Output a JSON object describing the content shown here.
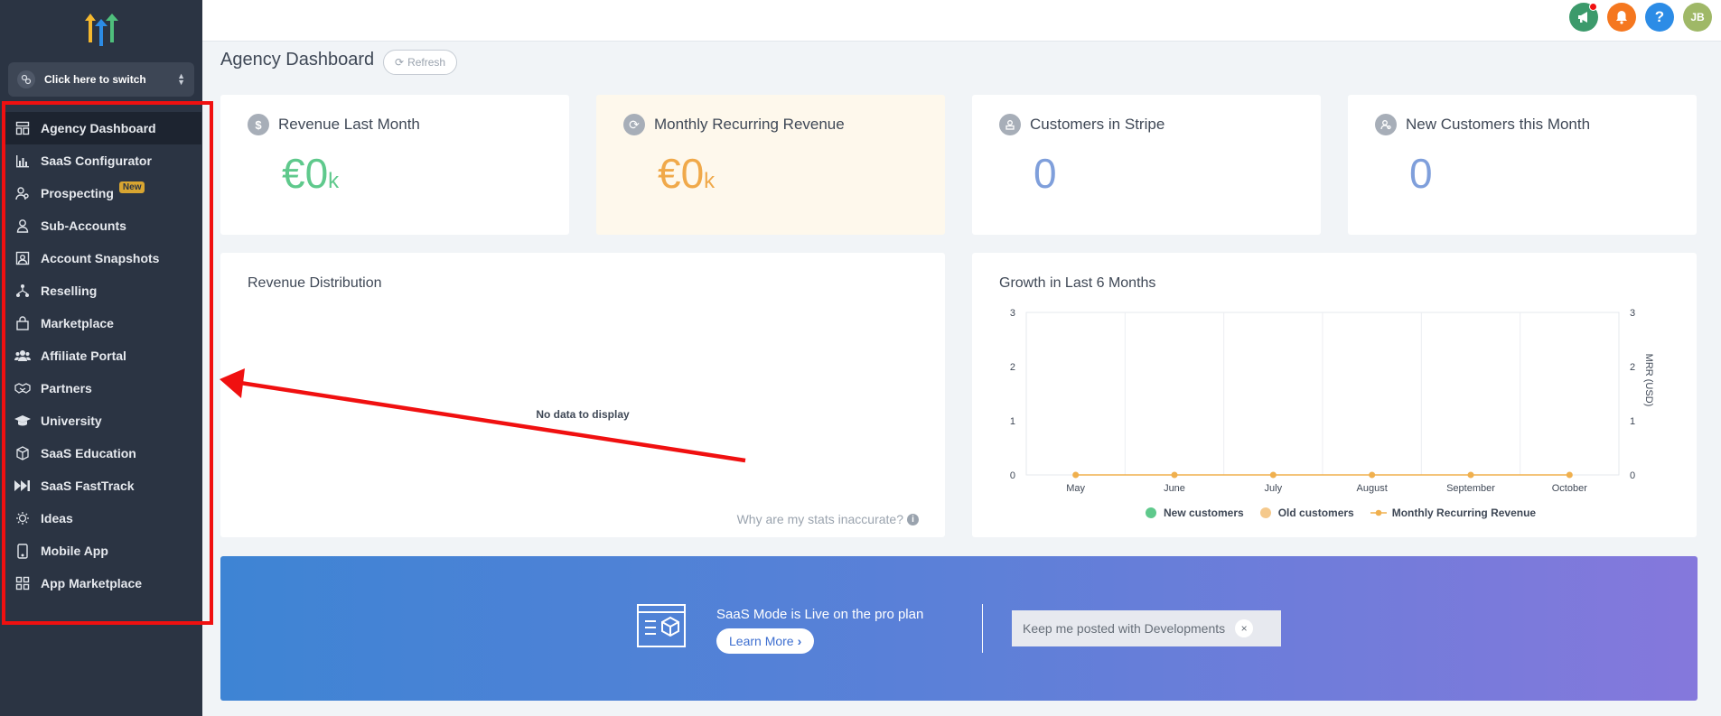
{
  "sidebar": {
    "switcher_label": "Click here to switch",
    "items": [
      {
        "label": "Agency Dashboard",
        "icon": "dashboard-icon",
        "active": true
      },
      {
        "label": "SaaS Configurator",
        "icon": "bar-chart-icon"
      },
      {
        "label": "Prospecting",
        "icon": "prospecting-icon",
        "badge": "New"
      },
      {
        "label": "Sub-Accounts",
        "icon": "user-icon"
      },
      {
        "label": "Account Snapshots",
        "icon": "snapshot-icon"
      },
      {
        "label": "Reselling",
        "icon": "reselling-icon"
      },
      {
        "label": "Marketplace",
        "icon": "shopping-bag-icon"
      },
      {
        "label": "Affiliate Portal",
        "icon": "users-icon"
      },
      {
        "label": "Partners",
        "icon": "handshake-icon"
      },
      {
        "label": "University",
        "icon": "graduation-cap-icon"
      },
      {
        "label": "SaaS Education",
        "icon": "cube-icon"
      },
      {
        "label": "SaaS FastTrack",
        "icon": "fast-forward-icon"
      },
      {
        "label": "Ideas",
        "icon": "lightbulb-icon"
      },
      {
        "label": "Mobile App",
        "icon": "mobile-icon"
      },
      {
        "label": "App Marketplace",
        "icon": "grid-icon"
      }
    ]
  },
  "topbar": {
    "avatar_initials": "JB",
    "icons": [
      "megaphone-icon",
      "bell-icon",
      "help-icon"
    ]
  },
  "main": {
    "title": "Agency Dashboard",
    "refresh_label": "Refresh",
    "stats": [
      {
        "title": "Revenue Last Month",
        "value": "€0",
        "suffix": "k",
        "color": "#5fc98c",
        "icon": "dollar-icon"
      },
      {
        "title": "Monthly Recurring Revenue",
        "value": "€0",
        "suffix": "k",
        "color": "#f0a94a",
        "icon": "recurring-icon"
      },
      {
        "title": "Customers in Stripe",
        "value": "0",
        "suffix": "",
        "color": "#7f9fdb",
        "icon": "customer-icon"
      },
      {
        "title": "New Customers this Month",
        "value": "0",
        "suffix": "",
        "color": "#7f9fdb",
        "icon": "new-customer-icon"
      }
    ],
    "revenue_distribution": {
      "title": "Revenue Distribution",
      "empty_text": "No data to display",
      "stats_link": "Why are my stats inaccurate?"
    },
    "growth": {
      "title": "Growth in Last 6 Months"
    }
  },
  "chart_data": {
    "type": "line",
    "title": "Growth in Last 6 Months",
    "categories": [
      "May",
      "June",
      "July",
      "August",
      "September",
      "October"
    ],
    "y_left_ticks": [
      "0",
      "1",
      "2",
      "3"
    ],
    "y_right_ticks": [
      "0",
      "1",
      "2",
      "3"
    ],
    "ylabel_right": "MRR (USD)",
    "ylim": [
      0,
      3
    ],
    "grid": true,
    "legend_position": "bottom",
    "series": [
      {
        "name": "New customers",
        "values": [
          0,
          0,
          0,
          0,
          0,
          0
        ],
        "color": "#5fc98c"
      },
      {
        "name": "Old customers",
        "values": [
          0,
          0,
          0,
          0,
          0,
          0
        ],
        "color": "#f5c98c"
      },
      {
        "name": "Monthly Recurring Revenue",
        "values": [
          0,
          0,
          0,
          0,
          0,
          0
        ],
        "color": "#f0b04e"
      }
    ]
  },
  "banner": {
    "text": "SaaS Mode is Live on the pro plan",
    "learn_more": "Learn More",
    "keep_posted": "Keep me posted with Developments",
    "close": "×"
  },
  "colors": {
    "sidebar_bg": "#2b3443",
    "highlight": "#f01010",
    "topbar_green": "#3c9a6b",
    "topbar_orange": "#f5771f",
    "topbar_blue": "#2c8ce6",
    "avatar_bg": "#9fb867"
  }
}
